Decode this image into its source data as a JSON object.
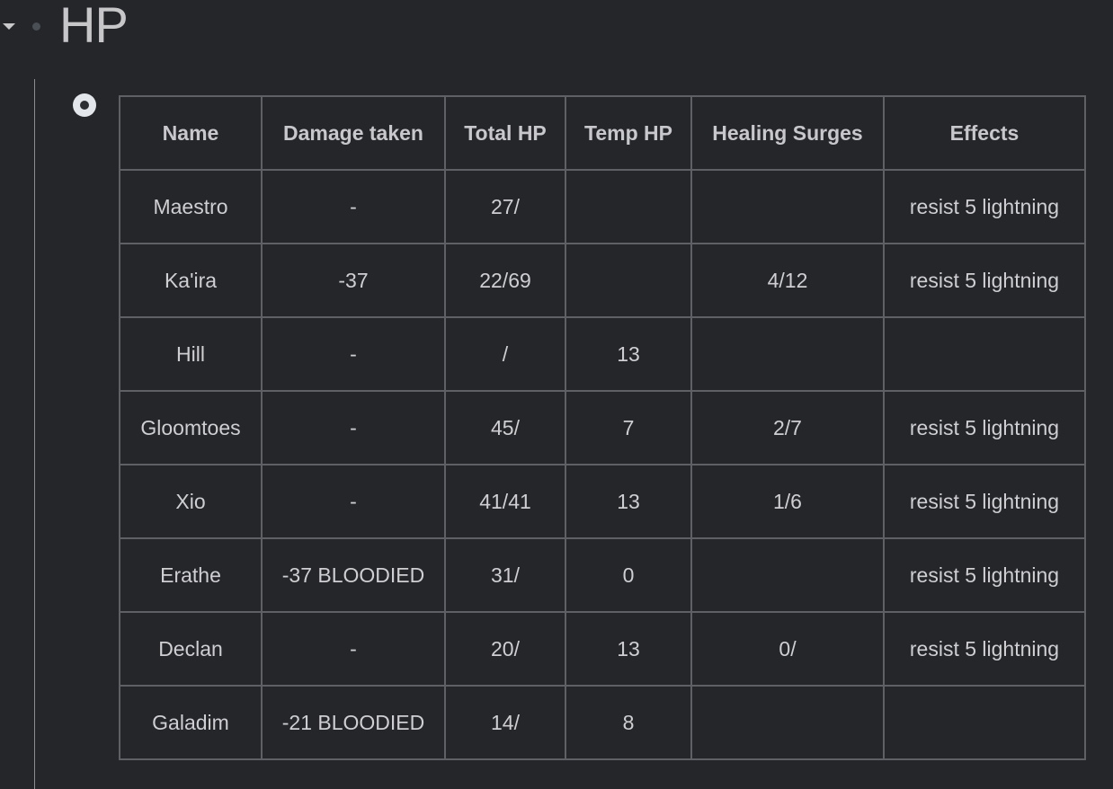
{
  "page": {
    "heading": "HP"
  },
  "table": {
    "headers": [
      "Name",
      "Damage taken",
      "Total HP",
      "Temp HP",
      "Healing Surges",
      "Effects"
    ],
    "rows": [
      [
        "Maestro",
        "-",
        "27/",
        "",
        "",
        "resist 5 lightning"
      ],
      [
        "Ka'ira",
        "-37",
        "22/69",
        "",
        "4/12",
        "resist 5 lightning"
      ],
      [
        "Hill",
        "-",
        "/",
        "13",
        "",
        ""
      ],
      [
        "Gloomtoes",
        "-",
        "45/",
        "7",
        "2/7",
        "resist 5 lightning"
      ],
      [
        "Xio",
        "-",
        "41/41",
        "13",
        "1/6",
        "resist 5 lightning"
      ],
      [
        "Erathe",
        "-37 BLOODIED",
        "31/",
        "0",
        "",
        "resist 5 lightning"
      ],
      [
        "Declan",
        "-",
        "20/",
        "13",
        "0/",
        "resist 5 lightning"
      ],
      [
        "Galadim",
        "-21 BLOODIED",
        "14/",
        "8",
        "",
        ""
      ]
    ]
  },
  "icons": {
    "collapse": "caret-down-icon",
    "heading_bullet": "bullet-icon",
    "block_bullet": "collapsed-bullet-icon"
  },
  "colors": {
    "background": "#25262a",
    "border": "#5e6066",
    "text": "#cfcfd2"
  }
}
